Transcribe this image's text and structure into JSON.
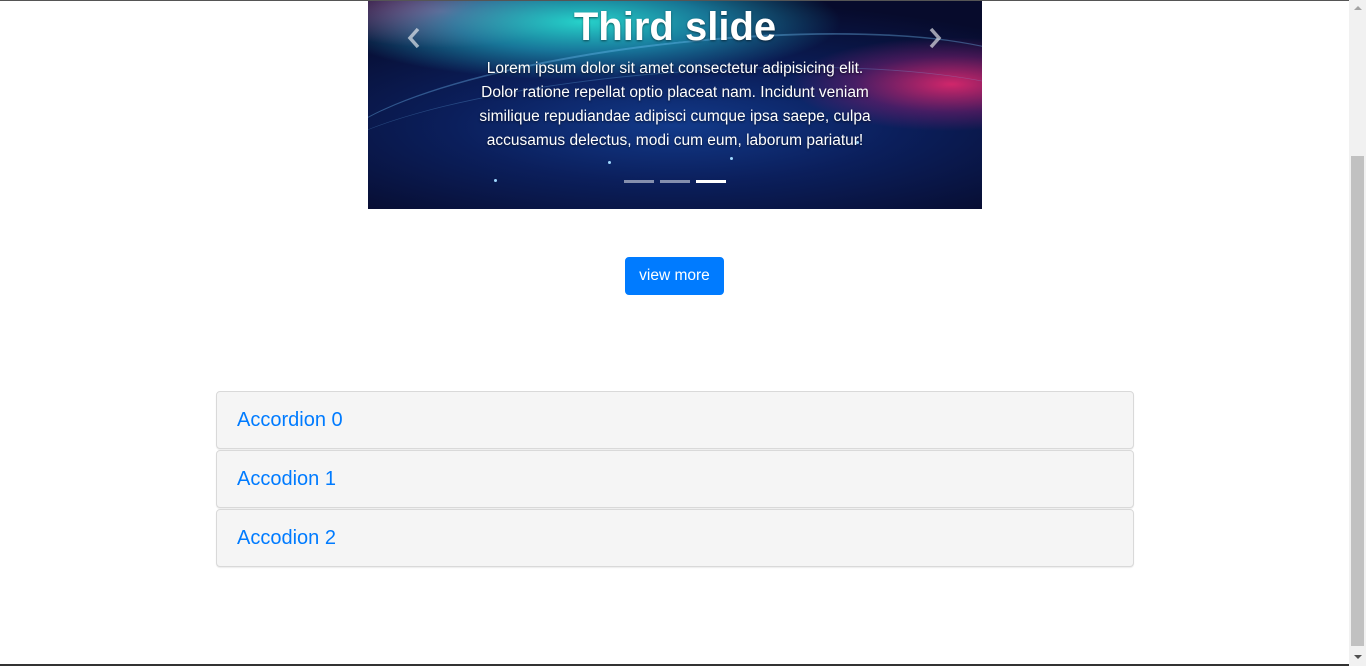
{
  "carousel": {
    "title": "Third slide",
    "text": "Lorem ipsum dolor sit amet consectetur adipisicing elit. Dolor ratione repellat optio placeat nam. Incidunt veniam similique repudiandae adipisci cumque ipsa saepe, culpa accusamus delectus, modi cum eum, laborum pariatur!",
    "indicator_count": 3,
    "active_index": 2,
    "prev_icon": "chevron-left-icon",
    "next_icon": "chevron-right-icon"
  },
  "view_more": {
    "label": "view more",
    "color": "#007bff"
  },
  "accordion": {
    "items": [
      {
        "label": "Accordion 0"
      },
      {
        "label": "Accodion 1"
      },
      {
        "label": "Accodion 2"
      }
    ],
    "link_color": "#007bff"
  }
}
